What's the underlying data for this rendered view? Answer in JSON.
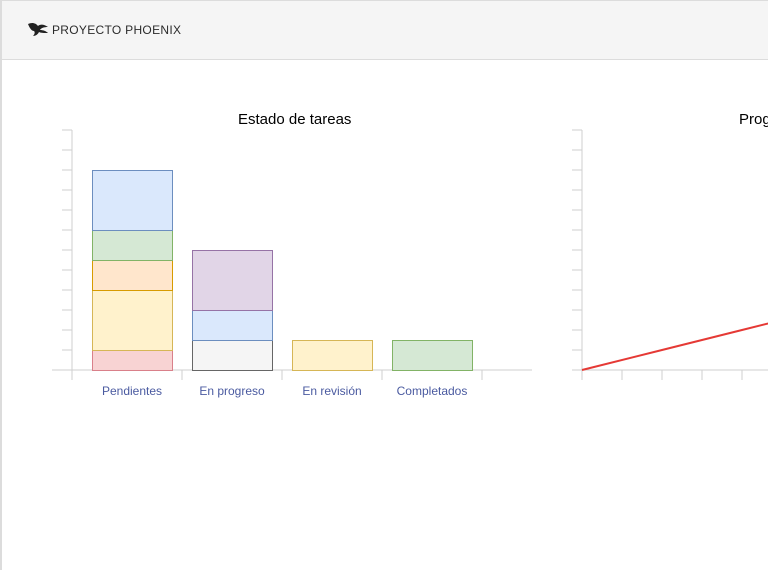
{
  "header": {
    "title": "PROYECTO PHOENIX",
    "logo_icon": "phoenix-logo-icon"
  },
  "charts": {
    "status": {
      "title": "Estado de tareas"
    },
    "progress": {
      "title": "Prog"
    }
  },
  "chart_data": [
    {
      "type": "bar",
      "stacked": true,
      "title": "Estado de tareas",
      "categories": [
        "Pendientes",
        "En progreso",
        "En revisión",
        "Completados"
      ],
      "ylim": [
        0,
        12
      ],
      "grid": false,
      "stacks": [
        [
          {
            "value": 1,
            "color": "#f8d3d3",
            "stroke": "#d9808a"
          },
          {
            "value": 3,
            "color": "#fff2cc",
            "stroke": "#d6b656"
          },
          {
            "value": 1.5,
            "color": "#ffe6cc",
            "stroke": "#d79b00"
          },
          {
            "value": 1.5,
            "color": "#d5e8d4",
            "stroke": "#82b366"
          },
          {
            "value": 3,
            "color": "#dae8fc",
            "stroke": "#6c8ebf"
          }
        ],
        [
          {
            "value": 1.5,
            "color": "#f5f5f5",
            "stroke": "#666666"
          },
          {
            "value": 1.5,
            "color": "#dae8fc",
            "stroke": "#6c8ebf"
          },
          {
            "value": 3,
            "color": "#e1d5e7",
            "stroke": "#9673a6"
          }
        ],
        [
          {
            "value": 1.5,
            "color": "#fff2cc",
            "stroke": "#d6b656"
          }
        ],
        [
          {
            "value": 1.5,
            "color": "#d5e8d4",
            "stroke": "#82b366"
          }
        ]
      ]
    },
    {
      "type": "line",
      "title": "Prog",
      "x": [
        0,
        1,
        2,
        3,
        4,
        5
      ],
      "values": [
        0,
        1,
        2,
        3,
        3,
        3
      ],
      "ylim": [
        0,
        12
      ],
      "line_color": "#e53935"
    }
  ]
}
